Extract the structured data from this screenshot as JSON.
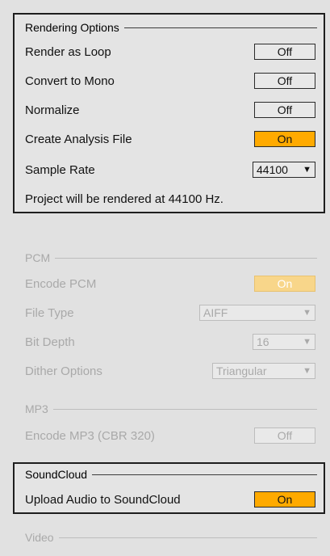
{
  "rendering": {
    "title": "Rendering Options",
    "render_loop": {
      "label": "Render as Loop",
      "value": "Off"
    },
    "mono": {
      "label": "Convert to Mono",
      "value": "Off"
    },
    "normalize": {
      "label": "Normalize",
      "value": "Off"
    },
    "analysis": {
      "label": "Create Analysis File",
      "value": "On"
    },
    "sample_rate": {
      "label": "Sample Rate",
      "value": "44100"
    },
    "note": "Project will be rendered at 44100 Hz."
  },
  "pcm": {
    "title": "PCM",
    "encode": {
      "label": "Encode PCM",
      "value": "On"
    },
    "file_type": {
      "label": "File Type",
      "value": "AIFF"
    },
    "bit_depth": {
      "label": "Bit Depth",
      "value": "16"
    },
    "dither": {
      "label": "Dither Options",
      "value": "Triangular"
    }
  },
  "mp3": {
    "title": "MP3",
    "encode": {
      "label": "Encode MP3 (CBR 320)",
      "value": "Off"
    }
  },
  "soundcloud": {
    "title": "SoundCloud",
    "upload": {
      "label": "Upload Audio to SoundCloud",
      "value": "On"
    }
  },
  "video": {
    "title": "Video"
  },
  "colors": {
    "accent_on": "#ffaa00",
    "disabled_on": "#f8d68a"
  },
  "icons": {
    "dropdown": "caret-down-icon"
  }
}
